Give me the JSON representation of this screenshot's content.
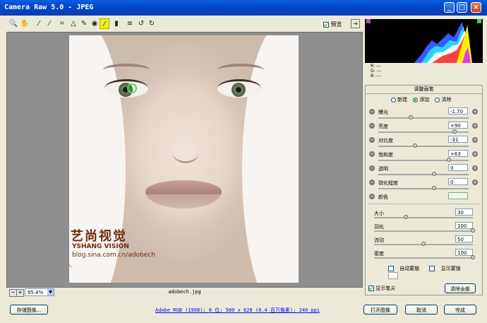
{
  "window": {
    "title": "Camera Raw 5.0 -  JPEG",
    "min": "_",
    "max": "□",
    "close": "×"
  },
  "toolbar": {
    "preview_label": "预览"
  },
  "canvas": {
    "filename": "adobech.jpg",
    "zoom": "95.4%",
    "watermark": {
      "cn": "艺尚视觉",
      "en": "YSHANG VISION",
      "url": "blog.sina.com.cn/adobech"
    }
  },
  "histogram": {
    "r": "R:  ---",
    "g": "G:  ---",
    "b": "B:  ---"
  },
  "panel": {
    "title": "调整画笔",
    "modes": [
      "新建",
      "添加",
      "清除"
    ],
    "sliders": [
      {
        "label": "曝光",
        "value": "-1.70",
        "pos": 0.36
      },
      {
        "label": "亮度",
        "value": "+90",
        "pos": 0.84
      },
      {
        "label": "对比度",
        "value": "-31",
        "pos": 0.41
      },
      {
        "label": "饱和度",
        "value": "+63",
        "pos": 0.78
      },
      {
        "label": "透明",
        "value": "0",
        "pos": 0.62
      },
      {
        "label": "锐化程度",
        "value": "0",
        "pos": 0.62
      }
    ],
    "color_label": "颜色",
    "brush": [
      {
        "label": "大小",
        "value": "30",
        "pos": 0.32
      },
      {
        "label": "羽化",
        "value": "100",
        "pos": 1.0
      },
      {
        "label": "流动",
        "value": "50",
        "pos": 0.5
      },
      {
        "label": "密度",
        "value": "100",
        "pos": 1.0
      }
    ],
    "auto_mask": "自动蒙版",
    "show_mask": "显示蒙版",
    "show_pins": "显示笔尖",
    "clear_all": "清除全部"
  },
  "footer": {
    "save": "存储图像...",
    "info": "Adobe RGB (1998); 8 位; 580 x 628 (0.4 百万像素); 240 ppi",
    "open": "打开图像",
    "cancel": "取消",
    "done": "完成"
  }
}
